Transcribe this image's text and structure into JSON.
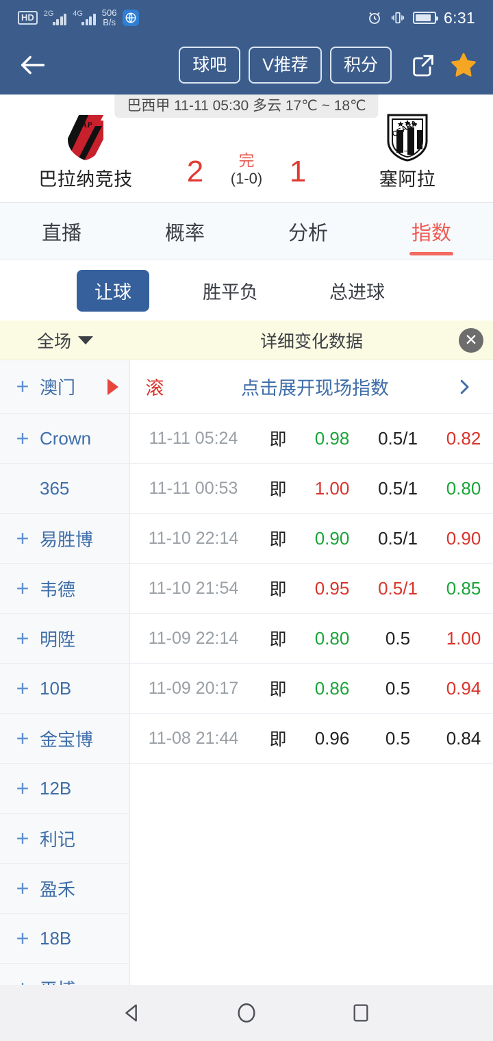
{
  "status_bar": {
    "hd_label": "HD",
    "sim1_label": "2G",
    "sim2_label": "4G",
    "net_speed_value": "506",
    "net_speed_unit": "B/s",
    "icons": [
      "hd-icon",
      "signal-2g-icon",
      "signal-4g-icon",
      "globe-icon",
      "alarm-icon",
      "vibrate-icon",
      "battery-icon"
    ],
    "time": "6:31"
  },
  "header": {
    "back_icon": "back-arrow-icon",
    "pills": [
      {
        "label": "球吧"
      },
      {
        "label": "V推荐"
      },
      {
        "label": "积分"
      }
    ],
    "share_icon": "share-icon",
    "favorite_icon": "star-icon",
    "background_color": "#3c5d8c"
  },
  "match": {
    "banner": "巴西甲 11-11 05:30 多云 17℃ ~ 18℃",
    "home_team": "巴拉纳竞技",
    "home_crest": "atletico-paranaense-crest",
    "home_score": "2",
    "away_team": "塞阿拉",
    "away_crest": "ceara-crest",
    "away_score": "1",
    "status": "完",
    "halftime": "(1-0)",
    "score_color": "#e03a32"
  },
  "tabs": {
    "items": [
      {
        "label": "直播",
        "active": false
      },
      {
        "label": "概率",
        "active": false
      },
      {
        "label": "分析",
        "active": false
      },
      {
        "label": "指数",
        "active": true
      }
    ],
    "active_color": "#ef5a52"
  },
  "subtabs": {
    "items": [
      {
        "label": "让球",
        "active": true
      },
      {
        "label": "胜平负",
        "active": false
      },
      {
        "label": "总进球",
        "active": false
      }
    ],
    "active_bg": "#35609b"
  },
  "filter_bar": {
    "scope_label": "全场",
    "caret_icon": "chevron-down-icon",
    "title": "详细变化数据",
    "close_icon": "close-icon",
    "background_color": "#fbfbe3"
  },
  "expand_row": {
    "bookmaker": "澳门",
    "plus_icon": "plus-icon",
    "marker_icon": "play-triangle-icon",
    "live_label": "滚",
    "expand_label": "点击展开现场指数",
    "chevron_icon": "chevron-right-icon"
  },
  "table": {
    "rows": [
      {
        "bookmaker": "Crown",
        "has_plus": true,
        "time": "11-11 05:24",
        "type": "即",
        "home_odds": "0.98",
        "home_trend": "up",
        "handicap": "0.5/1",
        "handicap_trend": "flat",
        "away_odds": "0.82",
        "away_trend": "down"
      },
      {
        "bookmaker": "365",
        "has_plus": false,
        "time": "11-11 00:53",
        "type": "即",
        "home_odds": "1.00",
        "home_trend": "down",
        "handicap": "0.5/1",
        "handicap_trend": "flat",
        "away_odds": "0.80",
        "away_trend": "up"
      },
      {
        "bookmaker": "易胜博",
        "has_plus": true,
        "time": "11-10 22:14",
        "type": "即",
        "home_odds": "0.90",
        "home_trend": "up",
        "handicap": "0.5/1",
        "handicap_trend": "flat",
        "away_odds": "0.90",
        "away_trend": "down"
      },
      {
        "bookmaker": "韦德",
        "has_plus": true,
        "time": "11-10 21:54",
        "type": "即",
        "home_odds": "0.95",
        "home_trend": "down",
        "handicap": "0.5/1",
        "handicap_trend": "down",
        "away_odds": "0.85",
        "away_trend": "up"
      },
      {
        "bookmaker": "明陞",
        "has_plus": true,
        "time": "11-09 22:14",
        "type": "即",
        "home_odds": "0.80",
        "home_trend": "up",
        "handicap": "0.5",
        "handicap_trend": "flat",
        "away_odds": "1.00",
        "away_trend": "down"
      },
      {
        "bookmaker": "10B",
        "has_plus": true,
        "time": "11-09 20:17",
        "type": "即",
        "home_odds": "0.86",
        "home_trend": "up",
        "handicap": "0.5",
        "handicap_trend": "flat",
        "away_odds": "0.94",
        "away_trend": "down"
      },
      {
        "bookmaker": "金宝博",
        "has_plus": true,
        "time": "11-08 21:44",
        "type": "即",
        "home_odds": "0.96",
        "home_trend": "flat",
        "handicap": "0.5",
        "handicap_trend": "flat",
        "away_odds": "0.84",
        "away_trend": "flat"
      },
      {
        "bookmaker": "12B",
        "has_plus": true,
        "time": "",
        "type": "",
        "home_odds": "",
        "home_trend": "flat",
        "handicap": "",
        "handicap_trend": "flat",
        "away_odds": "",
        "away_trend": "flat"
      },
      {
        "bookmaker": "利记",
        "has_plus": true,
        "time": "",
        "type": "",
        "home_odds": "",
        "home_trend": "flat",
        "handicap": "",
        "handicap_trend": "flat",
        "away_odds": "",
        "away_trend": "flat"
      },
      {
        "bookmaker": "盈禾",
        "has_plus": true,
        "time": "",
        "type": "",
        "home_odds": "",
        "home_trend": "flat",
        "handicap": "",
        "handicap_trend": "flat",
        "away_odds": "",
        "away_trend": "flat"
      },
      {
        "bookmaker": "18B",
        "has_plus": true,
        "time": "",
        "type": "",
        "home_odds": "",
        "home_trend": "flat",
        "handicap": "",
        "handicap_trend": "flat",
        "away_odds": "",
        "away_trend": "flat"
      },
      {
        "bookmaker": "平博",
        "has_plus": true,
        "time": "",
        "type": "",
        "home_odds": "",
        "home_trend": "flat",
        "handicap": "",
        "handicap_trend": "flat",
        "away_odds": "",
        "away_trend": "flat"
      }
    ],
    "trend_colors": {
      "up": "#1aa538",
      "down": "#d9342b",
      "flat": "#222222"
    }
  },
  "nav_bar": {
    "back_icon": "nav-back-triangle-icon",
    "home_icon": "nav-home-circle-icon",
    "recents_icon": "nav-recents-square-icon"
  }
}
